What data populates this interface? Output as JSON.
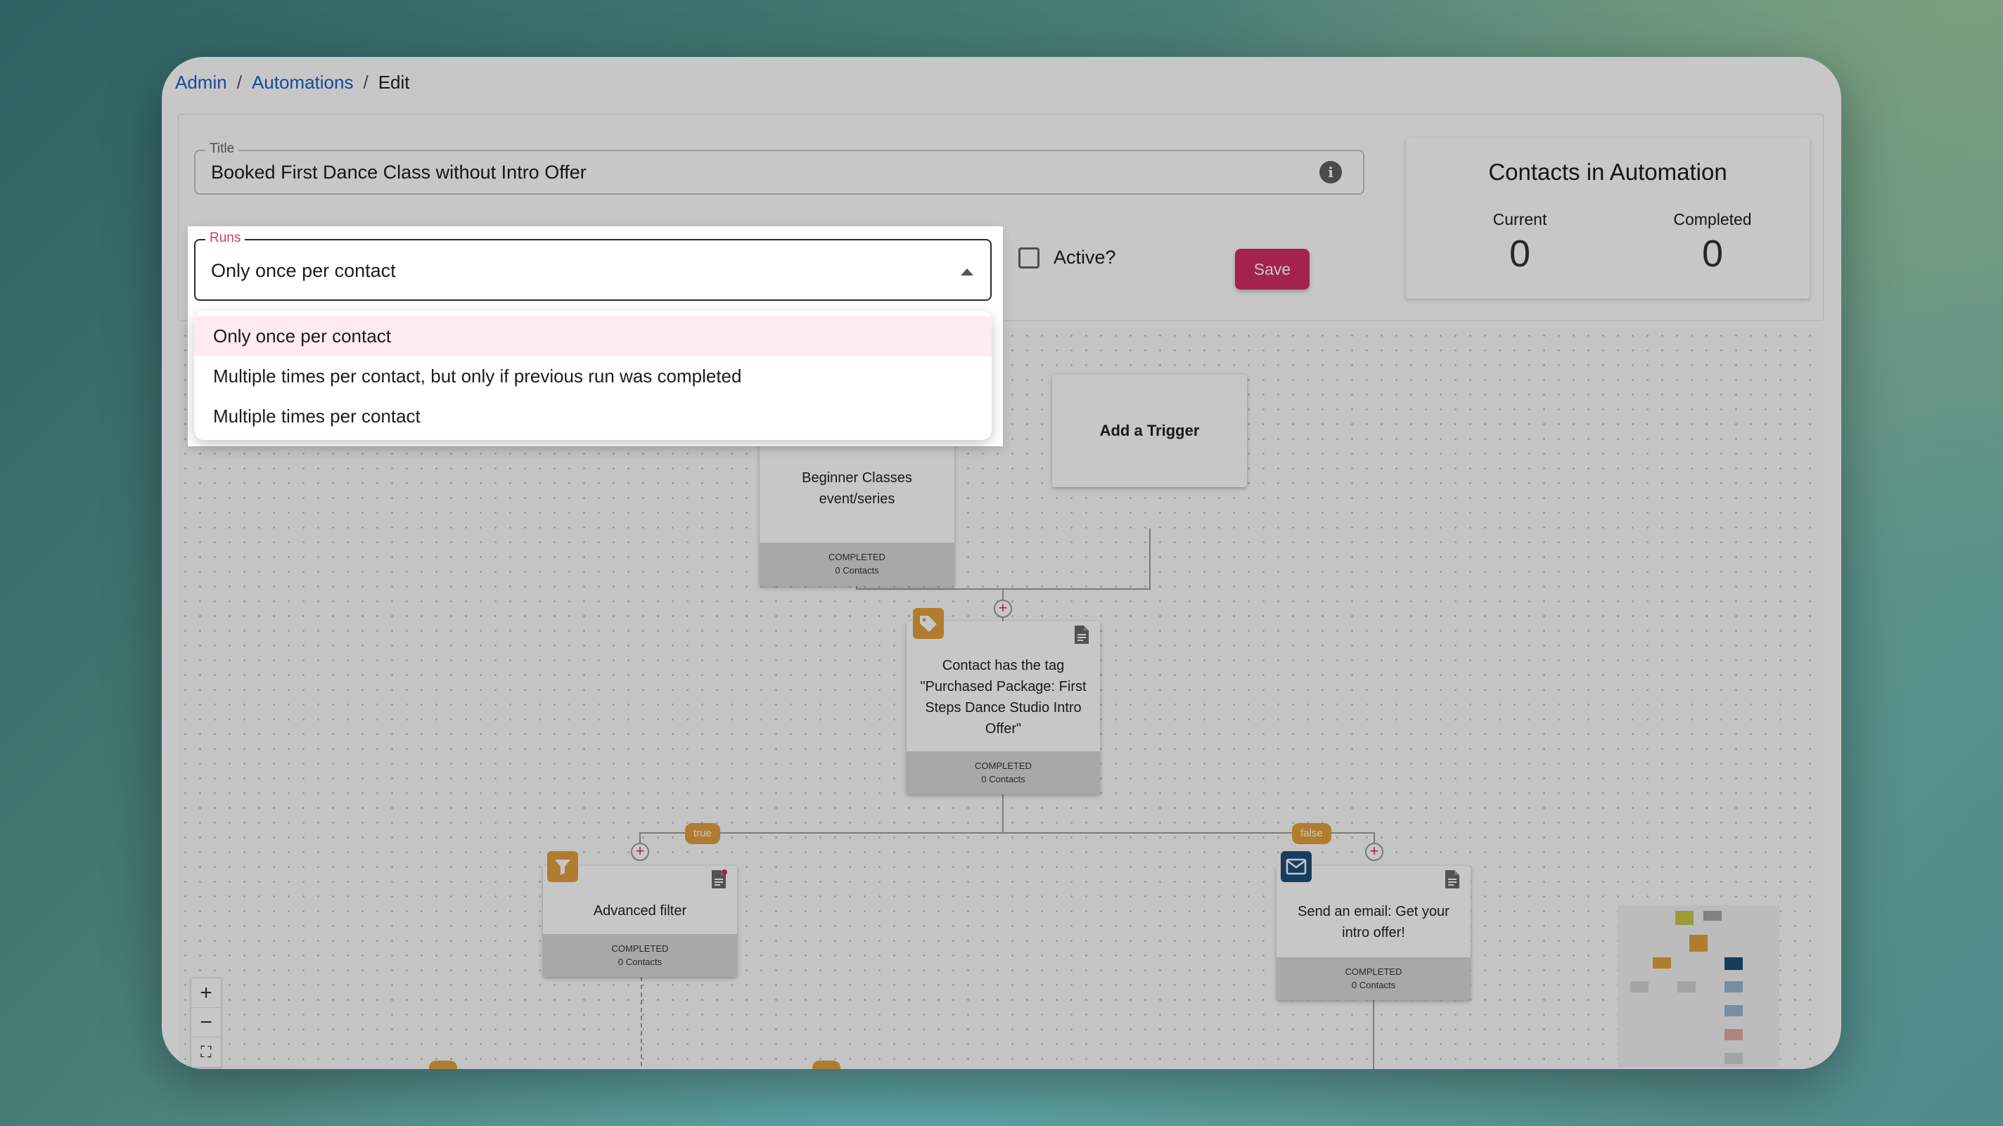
{
  "breadcrumb": {
    "admin": "Admin",
    "automations": "Automations",
    "current": "Edit",
    "separator": "/"
  },
  "form": {
    "title_label": "Title",
    "title_value": "Booked First Dance Class without Intro Offer",
    "runs_label": "Runs",
    "runs_value": "Only once per contact",
    "active_label": "Active?",
    "active_checked": false,
    "save_label": "Save"
  },
  "runs_options": [
    "Only once per contact",
    "Multiple times per contact, but only if previous run was completed",
    "Multiple times per contact"
  ],
  "stats": {
    "title": "Contacts in Automation",
    "current_label": "Current",
    "current_value": "0",
    "completed_label": "Completed",
    "completed_value": "0"
  },
  "nodes": {
    "trigger1": {
      "text": "Beginner Classes event/series",
      "status": "COMPLETED",
      "contacts": "0 Contacts"
    },
    "trigger_add": {
      "text": "Add a Trigger"
    },
    "tag_check": {
      "text": "Contact has the tag \"Purchased Package: First Steps Dance Studio Intro Offer\"",
      "status": "COMPLETED",
      "contacts": "0 Contacts"
    },
    "filter": {
      "text": "Advanced filter",
      "status": "COMPLETED",
      "contacts": "0 Contacts"
    },
    "email": {
      "text": "Send an email: Get your intro offer!",
      "status": "COMPLETED",
      "contacts": "0 Contacts"
    }
  },
  "branches": {
    "true_label": "true",
    "false_label": "false"
  },
  "zoom": {
    "in": "+",
    "out": "−",
    "fit": "⛶"
  },
  "colors": {
    "accent": "#d12e63",
    "link": "#1f5fbf",
    "branch": "#e2a03d",
    "email_icon": "#1f4e79"
  },
  "icons": [
    "info-icon",
    "caret-up-icon",
    "tag-icon",
    "filter-icon",
    "email-icon",
    "document-icon"
  ]
}
